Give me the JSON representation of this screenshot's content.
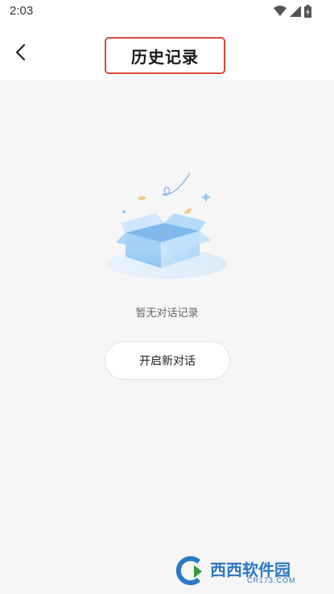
{
  "status_bar": {
    "time": "2:03",
    "icons": [
      "wifi-icon",
      "cellular-signal-icon",
      "battery-icon"
    ]
  },
  "header": {
    "title": "历史记录",
    "back_icon": "chevron-left-icon"
  },
  "empty_state": {
    "illustration": "open-box-illustration",
    "message": "暂无对话记录",
    "button_label": "开启新对话"
  },
  "watermark": {
    "text": "西西软件园",
    "sub": "CR173.COM"
  },
  "colors": {
    "highlight_border": "#d9493a",
    "background": "#f6f6f6",
    "box_blue": "#a9d2f5"
  }
}
